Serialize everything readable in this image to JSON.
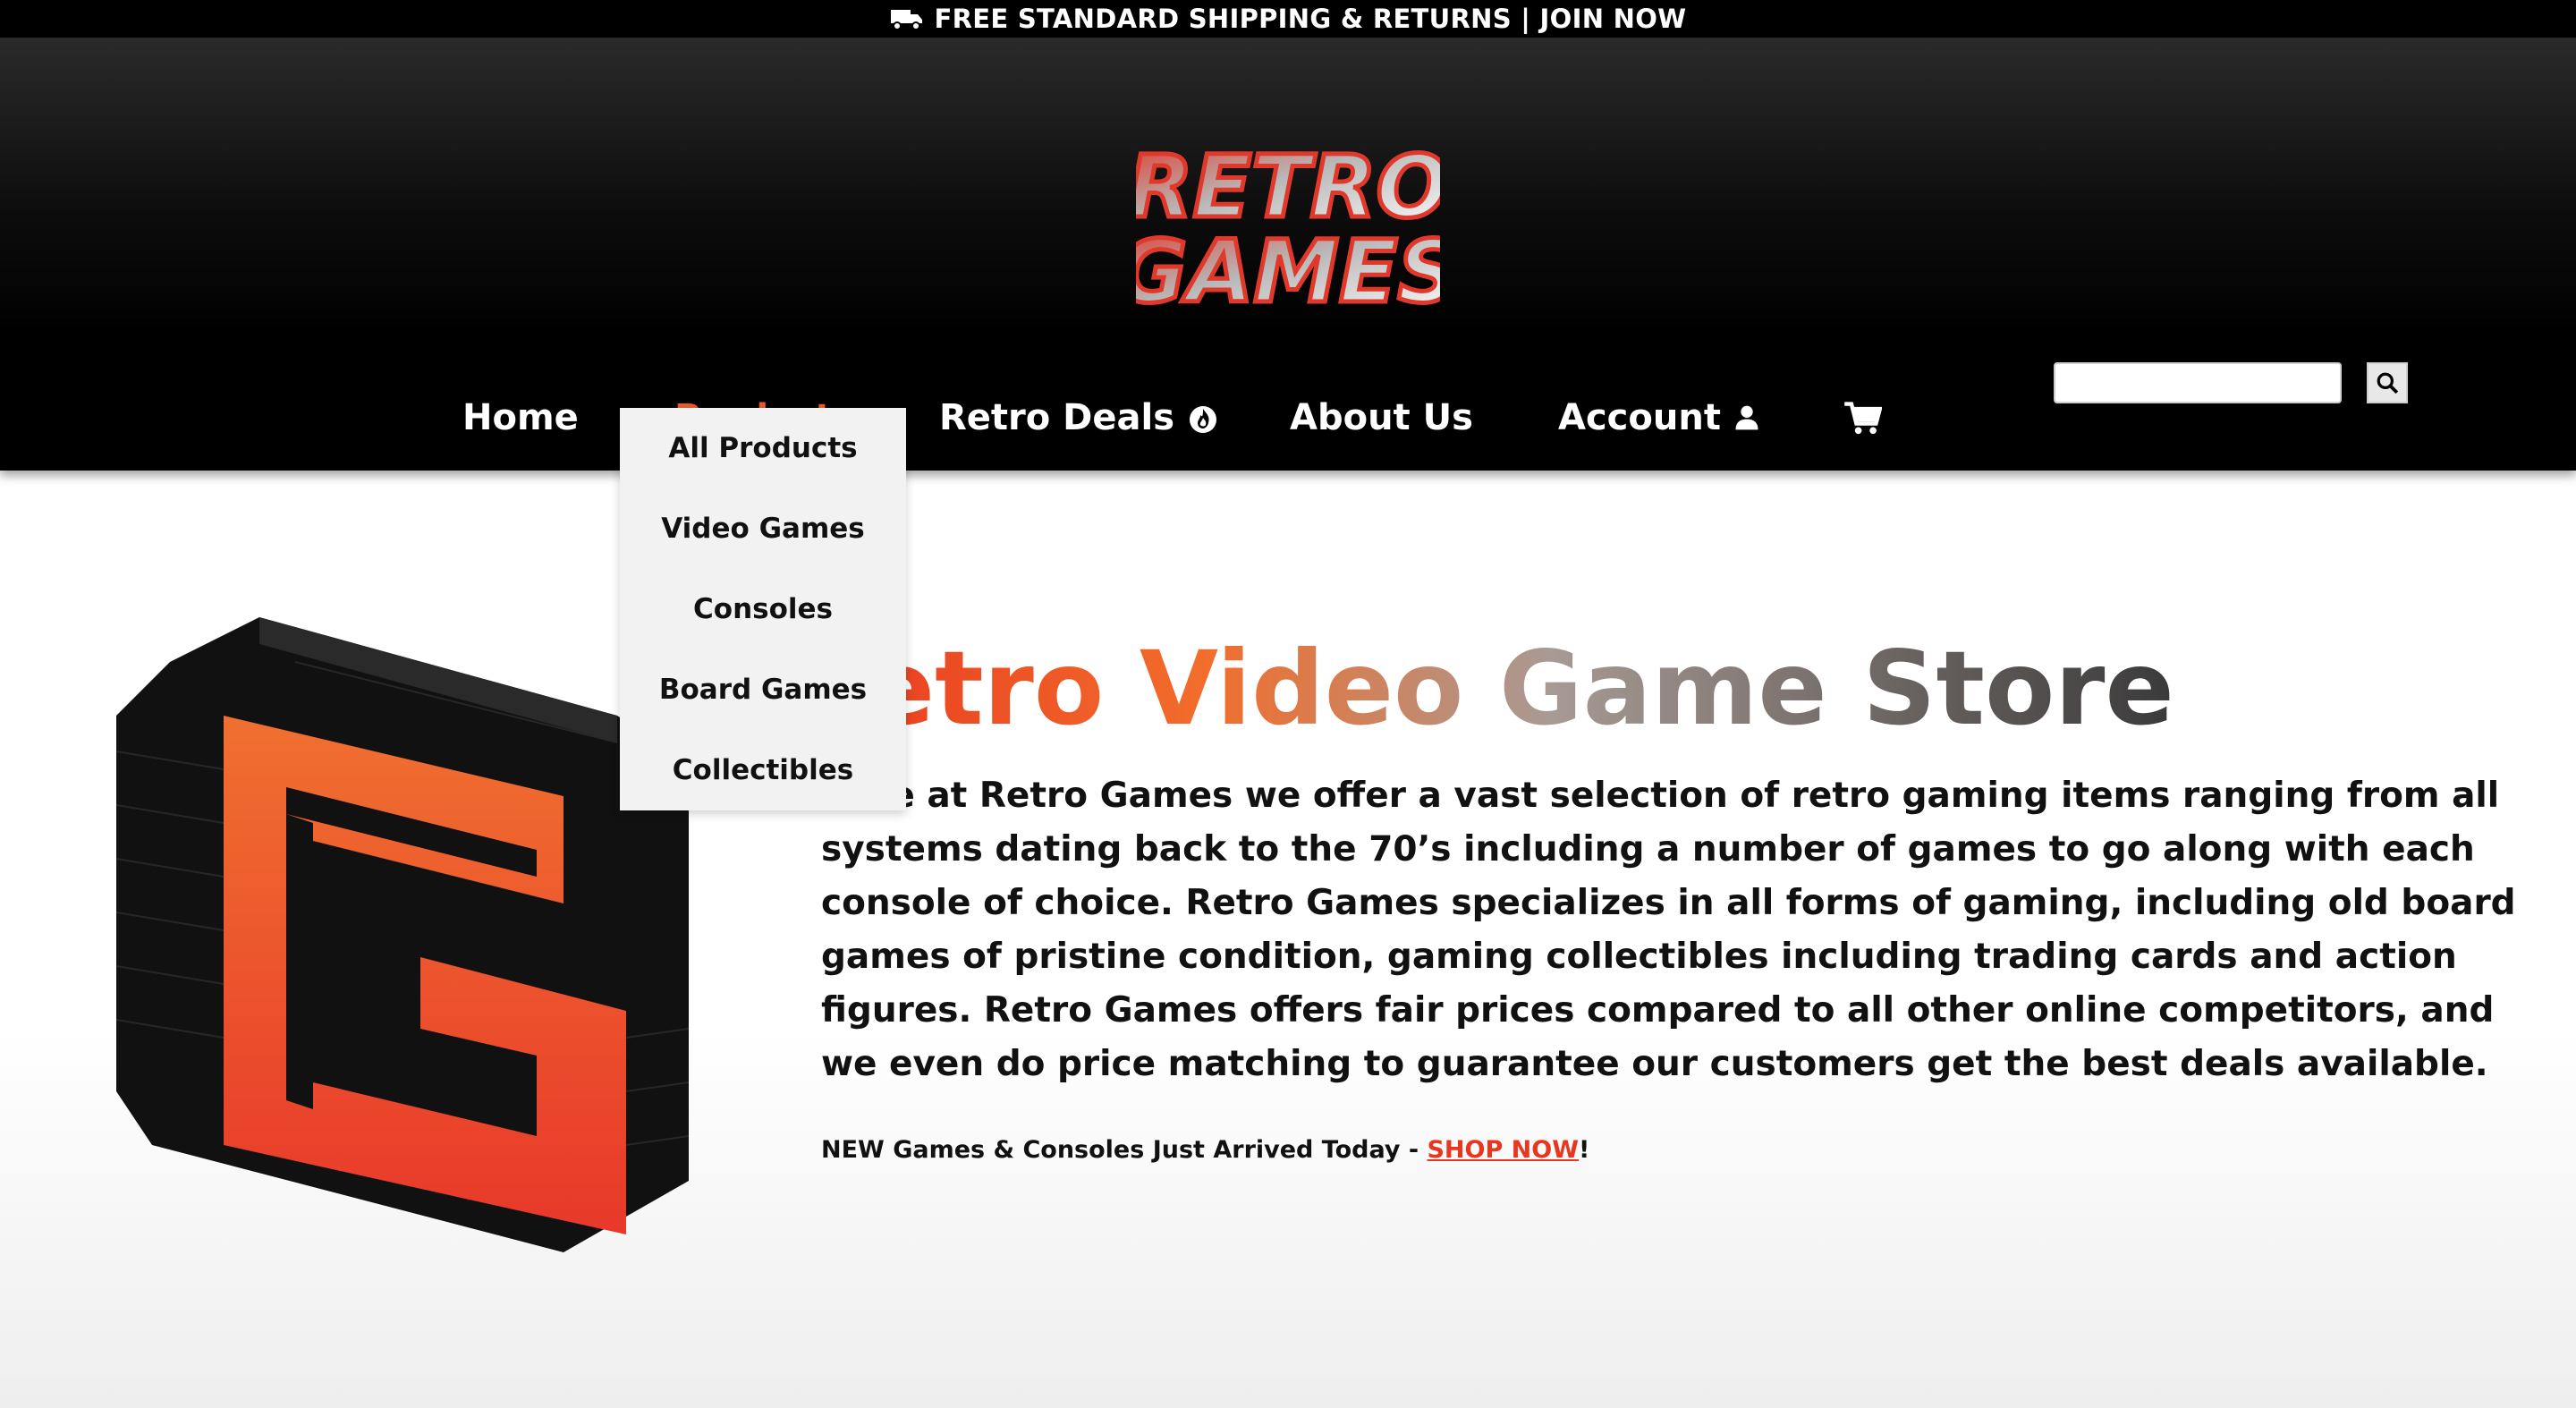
{
  "promo": {
    "text": "FREE STANDARD SHIPPING & RETURNS | JOIN NOW"
  },
  "logo": {
    "line1": "RETRO",
    "line2": "GAMES"
  },
  "nav": {
    "home": "Home",
    "products": "Products",
    "deals": "Retro Deals",
    "about": "About Us",
    "account": "Account"
  },
  "search": {
    "placeholder": ""
  },
  "dropdown": {
    "items": [
      "All Products",
      "Video Games",
      "Consoles",
      "Board Games",
      "Collectibles"
    ]
  },
  "hero": {
    "title": "Retro Video Game Store",
    "body": "Here at Retro Games we offer a vast selection of retro gaming items ranging from all systems dating back to the 70’s including a number of games to go along with each console of choice. Retro Games specializes in all forms of gaming, including old board games of pristine condition, gaming collectibles including trading cards and action figures. Retro Games offers fair prices compared to all other online competitors, and we even do price matching to guarantee our customers get the best deals available.",
    "cta_prefix": "NEW Games & Consoles Just Arrived Today - ",
    "cta_link": "SHOP NOW",
    "cta_suffix": "!"
  },
  "colors": {
    "accent": "#ee5a2a",
    "header_bg": "#000000",
    "link": "#e8361f"
  },
  "icons": [
    "truck-icon",
    "fire-icon",
    "user-icon",
    "cart-icon",
    "search-icon"
  ]
}
